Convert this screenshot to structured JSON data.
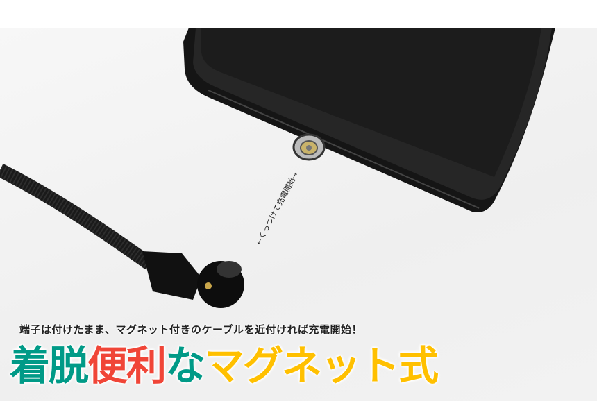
{
  "annotation": "←くっつけて充電開始→",
  "caption": "端子は付けたまま、マグネット付きのケーブルを近付ければ充電開始！",
  "headline": {
    "part1": "着脱",
    "part2": "便利",
    "part3": "な",
    "part4": "マグネット式"
  },
  "colors": {
    "teal": "#009a87",
    "red": "#f04537",
    "yellow": "#ffc000"
  }
}
